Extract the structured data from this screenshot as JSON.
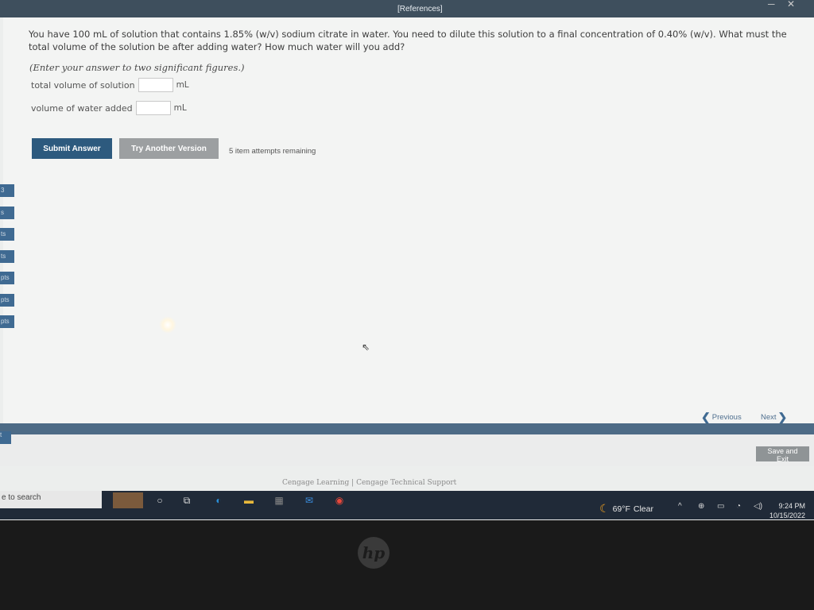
{
  "header": {
    "references_link": "[References]"
  },
  "question": {
    "text": "You have 100 mL of solution that contains 1.85% (w/v) sodium citrate in water. You need to dilute this solution to a final concentration of 0.40% (w/v). What must the total volume of the solution be after adding water? How much water will you add?",
    "hint": "(Enter your answer to two significant figures.)",
    "fields": [
      {
        "label": "total volume of solution",
        "unit": "mL",
        "value": ""
      },
      {
        "label": "volume of water added",
        "unit": "mL",
        "value": ""
      }
    ]
  },
  "actions": {
    "submit_label": "Submit Answer",
    "try_another_label": "Try Another Version",
    "attempts_text": "5 item attempts remaining"
  },
  "sidebar_fragments": [
    "3",
    "s",
    "ts",
    "ts",
    "pts",
    "pts",
    "pts"
  ],
  "sidebar_exit_fragment": "t",
  "navigation": {
    "previous_label": "Previous",
    "next_label": "Next"
  },
  "save_exit_label": "Save and Exit",
  "footer": {
    "links": [
      "Cengage Learning",
      "Cengage Technical Support"
    ],
    "separator": "|"
  },
  "taskbar": {
    "search_placeholder": "e to search",
    "weather": {
      "temp": "69°F",
      "condition": "Clear"
    },
    "clock": {
      "time": "9:24 PM",
      "date": "10/15/2022"
    }
  },
  "bezel_logo_text": "hp",
  "colors": {
    "accent": "#2d5a7e",
    "nav_bar": "#4d6b86",
    "button_gray": "#9c9fa1"
  }
}
